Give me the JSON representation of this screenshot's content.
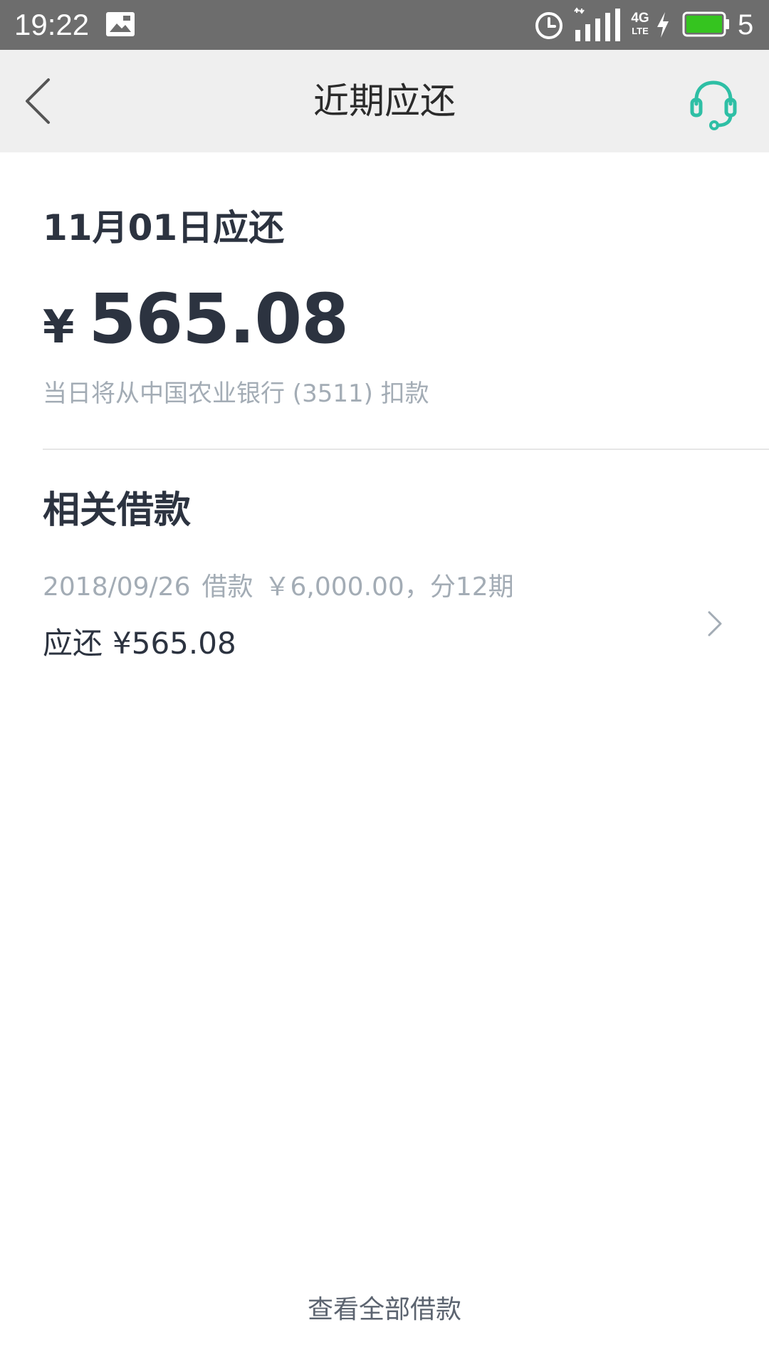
{
  "status_bar": {
    "time": "19:22",
    "network_generation": "4G",
    "network_type": "LTE",
    "battery_level": "5",
    "battery_color": "#35c41f",
    "icons": [
      "gallery-icon",
      "alarm-icon",
      "signal-icon",
      "charging-icon",
      "battery-icon"
    ]
  },
  "nav": {
    "title": "近期应还",
    "back_icon": "back-chevron-icon",
    "support_icon": "headset-icon",
    "accent_color": "#2ebfa5"
  },
  "due": {
    "date_label": "11月01日应还",
    "currency": "¥",
    "amount": "565.08",
    "debit_note": "当日将从中国农业银行 (3511) 扣款"
  },
  "related": {
    "title": "相关借款",
    "loans": [
      {
        "date": "2018/09/26",
        "label": "借款",
        "principal": "￥6,000.00，分12期",
        "due_label": "应还",
        "due_amount": "¥565.08"
      }
    ]
  },
  "footer": {
    "view_all_label": "查看全部借款"
  }
}
